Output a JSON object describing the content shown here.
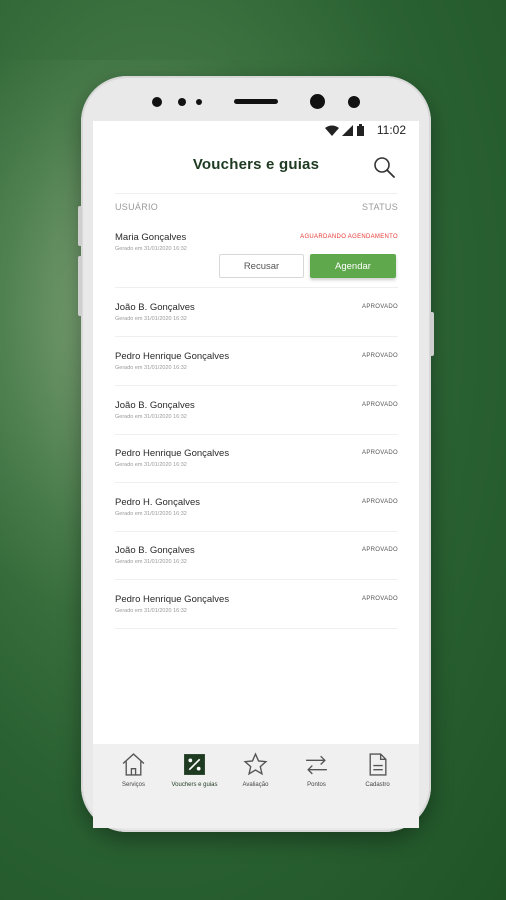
{
  "status_bar": {
    "time": "11:02"
  },
  "header": {
    "title": "Vouchers e guias"
  },
  "columns": {
    "user": "USUÁRIO",
    "status": "STATUS"
  },
  "actions": {
    "refuse_label": "Recusar",
    "schedule_label": "Agendar"
  },
  "vouchers": [
    {
      "name": "Maria Gonçalves",
      "date": "Gerado em 31/01/2020 16:32",
      "status": "AGUARDANDO AGENDAMENTO",
      "pending": true
    },
    {
      "name": "João B. Gonçalves",
      "date": "Gerado em 31/01/2020 16:32",
      "status": "APROVADO"
    },
    {
      "name": "Pedro Henrique Gonçalves",
      "date": "Gerado em 31/01/2020 16:32",
      "status": "APROVADO"
    },
    {
      "name": "João B. Gonçalves",
      "date": "Gerado em 31/01/2020 16:32",
      "status": "APROVADO"
    },
    {
      "name": "Pedro Henrique Gonçalves",
      "date": "Gerado em 31/01/2020 16:32",
      "status": "APROVADO"
    },
    {
      "name": "Pedro H. Gonçalves",
      "date": "Gerado em 31/01/2020 16:32",
      "status": "APROVADO"
    },
    {
      "name": "João B. Gonçalves",
      "date": "Gerado em 31/01/2020 16:32",
      "status": "APROVADO"
    },
    {
      "name": "Pedro Henrique Gonçalves",
      "date": "Gerado em 31/01/2020 16:32",
      "status": "APROVADO"
    }
  ],
  "bottom_nav": [
    {
      "label": "Serviços",
      "icon": "home-icon"
    },
    {
      "label": "Vouchers e guias",
      "icon": "voucher-percent-icon",
      "active": true
    },
    {
      "label": "Avaliação",
      "icon": "star-icon"
    },
    {
      "label": "Pontos",
      "icon": "swap-arrows-icon"
    },
    {
      "label": "Cadastro",
      "icon": "document-icon"
    }
  ],
  "colors": {
    "accent_green": "#5fa94c",
    "title_green": "#1e3b22",
    "pending_red": "#e53935"
  }
}
